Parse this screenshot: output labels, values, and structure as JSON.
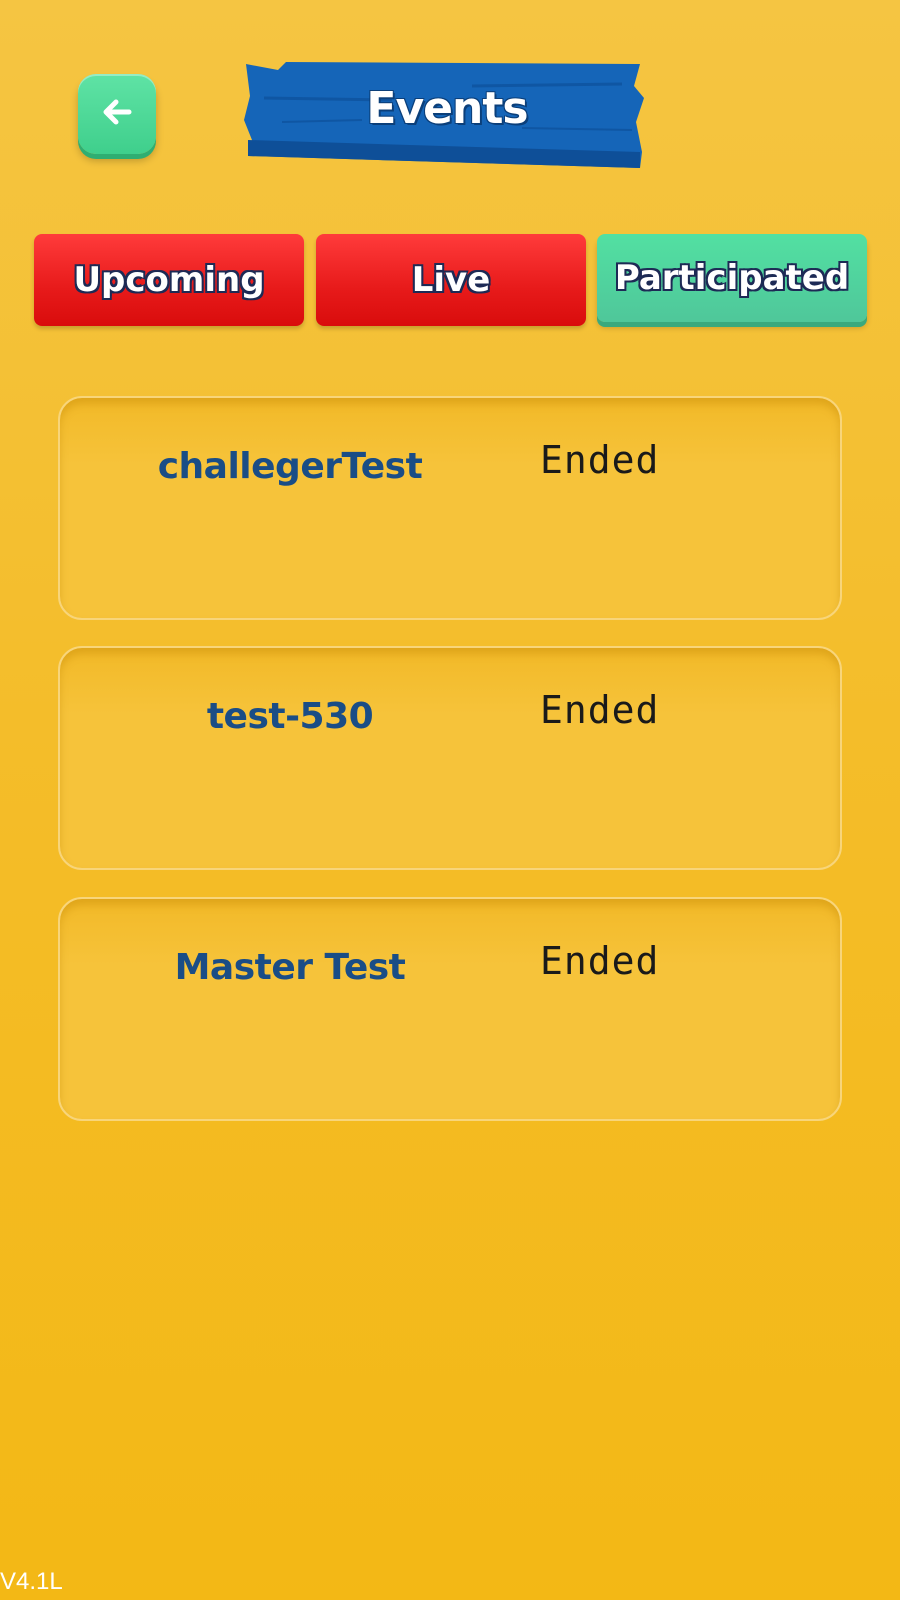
{
  "header": {
    "back_icon": "arrow-left-icon",
    "title": "Events",
    "banner_color": "#1565b8"
  },
  "tabs": [
    {
      "label": "Upcoming",
      "state": "inactive",
      "color": "#e71a1a"
    },
    {
      "label": "Live",
      "state": "inactive",
      "color": "#e71a1a"
    },
    {
      "label": "Participated",
      "state": "active",
      "color": "#4fc79a"
    }
  ],
  "events": [
    {
      "name": "challegerTest",
      "status": "Ended"
    },
    {
      "name": "test-530",
      "status": "Ended"
    },
    {
      "name": "Master Test",
      "status": "Ended"
    }
  ],
  "footer": {
    "version": "V4.1L"
  }
}
